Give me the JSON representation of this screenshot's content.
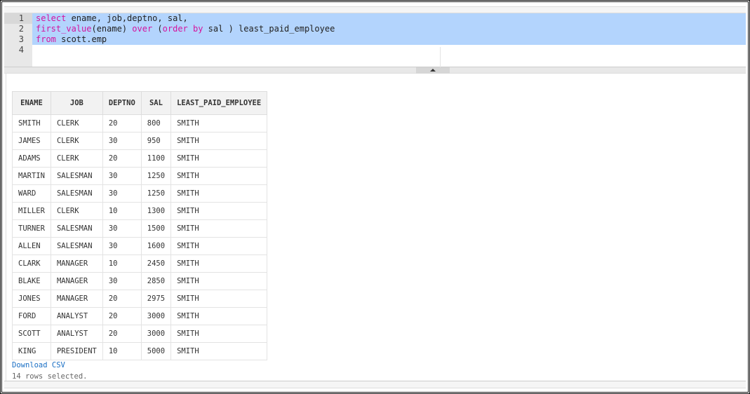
{
  "editor": {
    "line_numbers": [
      "1",
      "2",
      "3",
      "4"
    ],
    "lines": [
      [
        {
          "t": "select",
          "k": true
        },
        {
          "t": " ename, job,deptno, sal,",
          "k": false
        }
      ],
      [
        {
          "t": "first_value",
          "k": true
        },
        {
          "t": "(ename) ",
          "k": false
        },
        {
          "t": "over",
          "k": true
        },
        {
          "t": " (",
          "k": false
        },
        {
          "t": "order",
          "k": true
        },
        {
          "t": " ",
          "k": false
        },
        {
          "t": "by",
          "k": true
        },
        {
          "t": " sal ) least_paid_employee",
          "k": false
        }
      ],
      [
        {
          "t": "from",
          "k": true
        },
        {
          "t": " scott.emp",
          "k": false
        }
      ],
      []
    ]
  },
  "results": {
    "columns": [
      "ENAME",
      "JOB",
      "DEPTNO",
      "SAL",
      "LEAST_PAID_EMPLOYEE"
    ],
    "rows": [
      [
        "SMITH",
        "CLERK",
        "20",
        "800",
        "SMITH"
      ],
      [
        "JAMES",
        "CLERK",
        "30",
        "950",
        "SMITH"
      ],
      [
        "ADAMS",
        "CLERK",
        "20",
        "1100",
        "SMITH"
      ],
      [
        "MARTIN",
        "SALESMAN",
        "30",
        "1250",
        "SMITH"
      ],
      [
        "WARD",
        "SALESMAN",
        "30",
        "1250",
        "SMITH"
      ],
      [
        "MILLER",
        "CLERK",
        "10",
        "1300",
        "SMITH"
      ],
      [
        "TURNER",
        "SALESMAN",
        "30",
        "1500",
        "SMITH"
      ],
      [
        "ALLEN",
        "SALESMAN",
        "30",
        "1600",
        "SMITH"
      ],
      [
        "CLARK",
        "MANAGER",
        "10",
        "2450",
        "SMITH"
      ],
      [
        "BLAKE",
        "MANAGER",
        "30",
        "2850",
        "SMITH"
      ],
      [
        "JONES",
        "MANAGER",
        "20",
        "2975",
        "SMITH"
      ],
      [
        "FORD",
        "ANALYST",
        "20",
        "3000",
        "SMITH"
      ],
      [
        "SCOTT",
        "ANALYST",
        "20",
        "3000",
        "SMITH"
      ],
      [
        "KING",
        "PRESIDENT",
        "10",
        "5000",
        "SMITH"
      ]
    ],
    "download_label": "Download CSV",
    "status": "14 rows selected."
  },
  "colors": {
    "selection": "#b3d4fd",
    "keyword": "#d4149e",
    "link": "#1a6fc4"
  }
}
